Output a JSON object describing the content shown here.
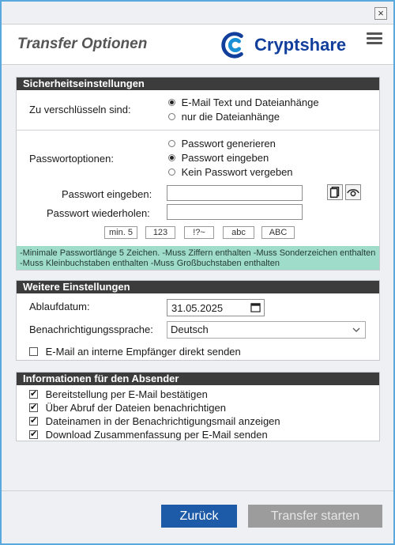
{
  "window": {
    "close_glyph": "×"
  },
  "header": {
    "title": "Transfer Optionen",
    "brand_name": "Cryptshare"
  },
  "security": {
    "heading": "Sicherheitseinstellungen",
    "encrypt_label": "Zu verschlüsseln sind:",
    "encrypt_options": [
      {
        "label": "E-Mail Text und Dateianhänge",
        "checked": true
      },
      {
        "label": "nur die Dateianhänge",
        "checked": false
      }
    ],
    "password_options_label": "Passwortoptionen:",
    "password_options": [
      {
        "label": "Passwort generieren",
        "checked": false
      },
      {
        "label": "Passwort eingeben",
        "checked": true
      },
      {
        "label": "Kein Passwort vergeben",
        "checked": false
      }
    ],
    "password_label": "Passwort eingeben:",
    "password_value": "",
    "password_repeat_label": "Passwort wiederholen:",
    "password_repeat_value": "",
    "chips": [
      "min. 5",
      "123",
      "!?~",
      "abc",
      "ABC"
    ],
    "rules_text": "-Minimale Passwortlänge 5 Zeichen. -Muss Ziffern enthalten -Muss Sonderzeichen enthalten -Muss Kleinbuchstaben enthalten -Muss Großbuchstaben enthalten"
  },
  "further": {
    "heading": "Weitere Einstellungen",
    "expiry_label": "Ablaufdatum:",
    "expiry_value": "31.05.2025",
    "language_label": "Benachrichtigungssprache:",
    "language_value": "Deutsch",
    "internal_label": "E-Mail an interne Empfänger direkt senden",
    "internal_checked": false
  },
  "sender": {
    "heading": "Informationen für den Absender",
    "items": [
      {
        "label": "Bereitstellung per E-Mail bestätigen",
        "checked": true
      },
      {
        "label": "Über Abruf der Dateien benachrichtigen",
        "checked": true
      },
      {
        "label": "Dateinamen in der Benachrichtigungsmail anzeigen",
        "checked": true
      },
      {
        "label": "Download Zusammenfassung per E-Mail senden",
        "checked": true
      }
    ]
  },
  "footer": {
    "back_label": "Zurück",
    "start_label": "Transfer starten"
  },
  "colors": {
    "brand": "#123f9c",
    "primary_button": "#1d5ba8",
    "info_bar": "#9fdcca",
    "frame": "#5aa9dc"
  }
}
